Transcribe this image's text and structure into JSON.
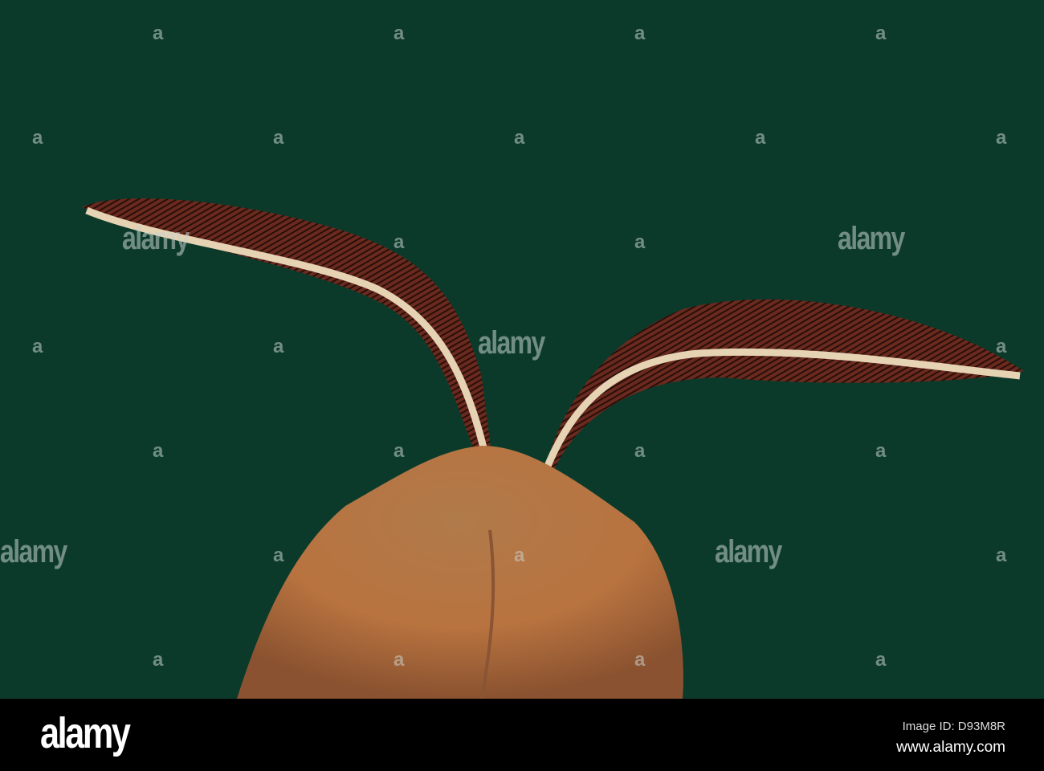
{
  "watermark": {
    "brand": "alamy",
    "small_mark": "a"
  },
  "footer": {
    "logo": "alamy",
    "image_id": "Image ID: D93M8R",
    "site": "www.alamy.com"
  }
}
